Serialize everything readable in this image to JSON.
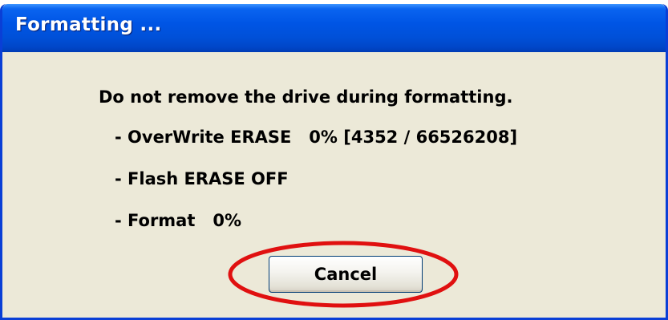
{
  "window": {
    "title": "Formatting ..."
  },
  "message": {
    "warning": "Do not remove the drive during formatting.",
    "overwrite_erase": "- OverWrite ERASE   0% [4352 / 66526208]",
    "flash_erase": "- Flash ERASE OFF",
    "format": "- Format   0%"
  },
  "buttons": {
    "cancel_label": "Cancel"
  },
  "colors": {
    "titlebar": "#0055E5",
    "window_background": "#ECE9D8",
    "annotation_ellipse": "#E01010"
  }
}
